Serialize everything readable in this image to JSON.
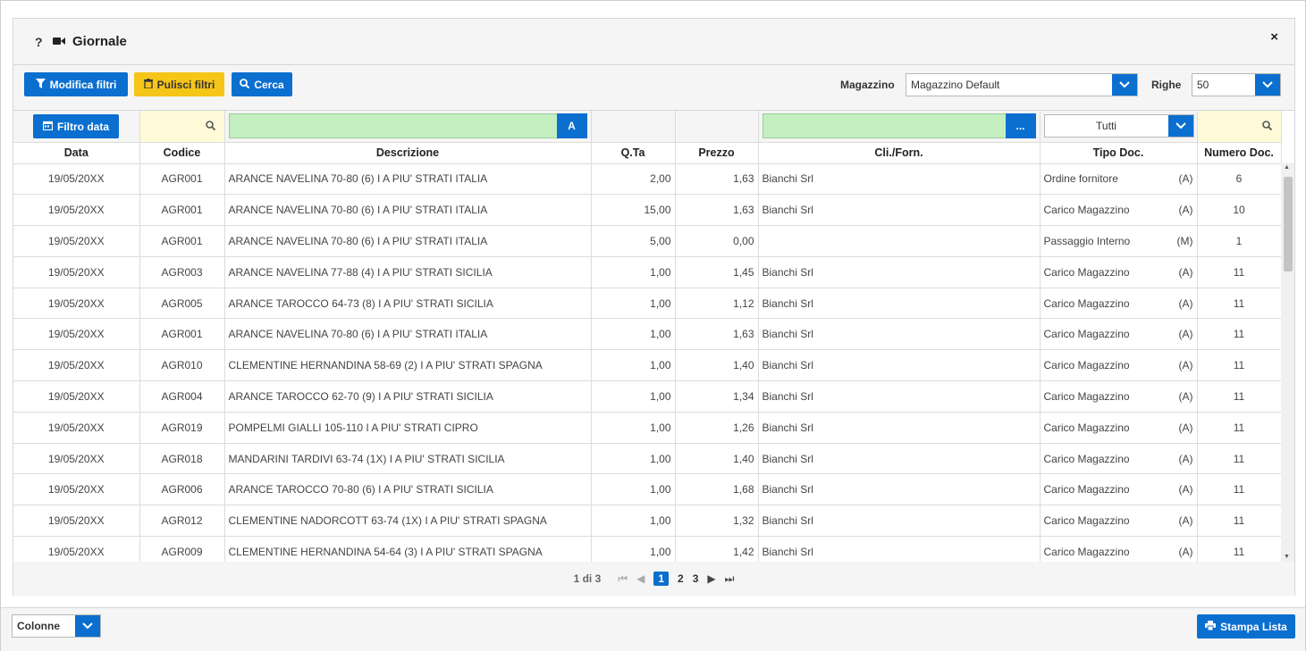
{
  "header": {
    "help": "?",
    "title": "Giornale",
    "close": "×"
  },
  "toolbar": {
    "modifica_filtri": "Modifica filtri",
    "pulisci_filtri": "Pulisci filtri",
    "cerca": "Cerca",
    "magazzino_label": "Magazzino",
    "magazzino_value": "Magazzino Default",
    "righe_label": "Righe",
    "righe_value": "50"
  },
  "filters": {
    "filtro_data": "Filtro data",
    "descrizione_btn": "A",
    "cliforn_btn": "...",
    "tipo_value": "Tutti"
  },
  "columns": [
    "Data",
    "Codice",
    "Descrizione",
    "Q.Ta",
    "Prezzo",
    "Cli./Forn.",
    "Tipo Doc.",
    "Numero Doc."
  ],
  "rows": [
    {
      "data": "19/05/20XX",
      "codice": "AGR001",
      "descrizione": "ARANCE NAVELINA 70-80 (6) I A PIU' STRATI ITALIA",
      "qta": "2,00",
      "prezzo": "1,63",
      "cliforn": "Bianchi Srl",
      "tipo": "Ordine fornitore",
      "tipo_code": "(A)",
      "numero": "6"
    },
    {
      "data": "19/05/20XX",
      "codice": "AGR001",
      "descrizione": "ARANCE NAVELINA 70-80 (6) I A PIU' STRATI ITALIA",
      "qta": "15,00",
      "prezzo": "1,63",
      "cliforn": "Bianchi Srl",
      "tipo": "Carico Magazzino",
      "tipo_code": "(A)",
      "numero": "10"
    },
    {
      "data": "19/05/20XX",
      "codice": "AGR001",
      "descrizione": "ARANCE NAVELINA 70-80 (6) I A PIU' STRATI ITALIA",
      "qta": "5,00",
      "prezzo": "0,00",
      "cliforn": "",
      "tipo": "Passaggio Interno",
      "tipo_code": "(M)",
      "numero": "1"
    },
    {
      "data": "19/05/20XX",
      "codice": "AGR003",
      "descrizione": "ARANCE NAVELINA 77-88 (4) I A PIU' STRATI SICILIA",
      "qta": "1,00",
      "prezzo": "1,45",
      "cliforn": "Bianchi Srl",
      "tipo": "Carico Magazzino",
      "tipo_code": "(A)",
      "numero": "11"
    },
    {
      "data": "19/05/20XX",
      "codice": "AGR005",
      "descrizione": "ARANCE TAROCCO 64-73 (8) I A PIU' STRATI SICILIA",
      "qta": "1,00",
      "prezzo": "1,12",
      "cliforn": "Bianchi Srl",
      "tipo": "Carico Magazzino",
      "tipo_code": "(A)",
      "numero": "11"
    },
    {
      "data": "19/05/20XX",
      "codice": "AGR001",
      "descrizione": "ARANCE NAVELINA 70-80 (6) I A PIU' STRATI ITALIA",
      "qta": "1,00",
      "prezzo": "1,63",
      "cliforn": "Bianchi Srl",
      "tipo": "Carico Magazzino",
      "tipo_code": "(A)",
      "numero": "11"
    },
    {
      "data": "19/05/20XX",
      "codice": "AGR010",
      "descrizione": "CLEMENTINE HERNANDINA 58-69 (2) I A PIU' STRATI SPAGNA",
      "qta": "1,00",
      "prezzo": "1,40",
      "cliforn": "Bianchi Srl",
      "tipo": "Carico Magazzino",
      "tipo_code": "(A)",
      "numero": "11"
    },
    {
      "data": "19/05/20XX",
      "codice": "AGR004",
      "descrizione": "ARANCE TAROCCO 62-70 (9) I A PIU' STRATI SICILIA",
      "qta": "1,00",
      "prezzo": "1,34",
      "cliforn": "Bianchi Srl",
      "tipo": "Carico Magazzino",
      "tipo_code": "(A)",
      "numero": "11"
    },
    {
      "data": "19/05/20XX",
      "codice": "AGR019",
      "descrizione": "POMPELMI GIALLI 105-110 I A PIU' STRATI CIPRO",
      "qta": "1,00",
      "prezzo": "1,26",
      "cliforn": "Bianchi Srl",
      "tipo": "Carico Magazzino",
      "tipo_code": "(A)",
      "numero": "11"
    },
    {
      "data": "19/05/20XX",
      "codice": "AGR018",
      "descrizione": "MANDARINI TARDIVI 63-74 (1X) I A PIU' STRATI SICILIA",
      "qta": "1,00",
      "prezzo": "1,40",
      "cliforn": "Bianchi Srl",
      "tipo": "Carico Magazzino",
      "tipo_code": "(A)",
      "numero": "11"
    },
    {
      "data": "19/05/20XX",
      "codice": "AGR006",
      "descrizione": "ARANCE TAROCCO 70-80 (6) I A PIU' STRATI SICILIA",
      "qta": "1,00",
      "prezzo": "1,68",
      "cliforn": "Bianchi Srl",
      "tipo": "Carico Magazzino",
      "tipo_code": "(A)",
      "numero": "11"
    },
    {
      "data": "19/05/20XX",
      "codice": "AGR012",
      "descrizione": "CLEMENTINE NADORCOTT 63-74 (1X) I A PIU' STRATI SPAGNA",
      "qta": "1,00",
      "prezzo": "1,32",
      "cliforn": "Bianchi Srl",
      "tipo": "Carico Magazzino",
      "tipo_code": "(A)",
      "numero": "11"
    },
    {
      "data": "19/05/20XX",
      "codice": "AGR009",
      "descrizione": "CLEMENTINE HERNANDINA 54-64 (3) I A PIU' STRATI SPAGNA",
      "qta": "1,00",
      "prezzo": "1,42",
      "cliforn": "Bianchi Srl",
      "tipo": "Carico Magazzino",
      "tipo_code": "(A)",
      "numero": "11"
    }
  ],
  "pager": {
    "info": "1 di 3",
    "pages": [
      "1",
      "2",
      "3"
    ],
    "current": "1"
  },
  "footer": {
    "colonne": "Colonne",
    "stampa": "Stampa Lista"
  },
  "colors": {
    "accent": "#0b6fcf",
    "warning": "#f5c518",
    "filter_green": "#c3eec0",
    "filter_yellow": "#fffbd9"
  }
}
